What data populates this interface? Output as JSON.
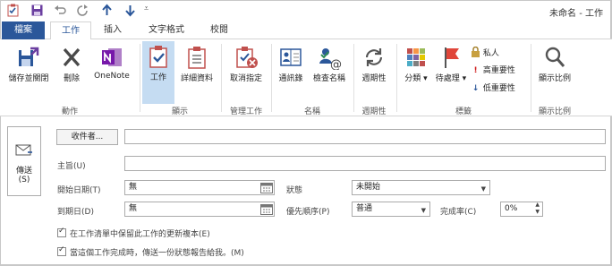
{
  "window_title": "未命名 - 工作",
  "tabs": {
    "file": "檔案",
    "task": "工作",
    "insert": "插入",
    "format": "文字格式",
    "review": "校閱"
  },
  "ribbon": {
    "save_close": "儲存並關閉",
    "delete": "刪除",
    "onenote": "OneNote",
    "task": "工作",
    "details": "詳細資料",
    "cancel_assign": "取消指定",
    "address_book": "通訊錄",
    "check_names": "檢查名稱",
    "recurrence": "週期性",
    "categorize": "分類",
    "follow_up": "待處理",
    "private": "私人",
    "high_importance": "高重要性",
    "low_importance": "低重要性",
    "zoom": "顯示比例",
    "groups": {
      "actions": "動作",
      "show": "顯示",
      "manage": "管理工作",
      "names": "名稱",
      "recurrence": "週期性",
      "tags": "標籤",
      "zoom": "顯示比例"
    }
  },
  "form": {
    "send_label": "傳送",
    "send_key": "(S)",
    "to_button": "收件者...",
    "to_value": "",
    "subject_label": "主旨(U)",
    "subject_value": "",
    "start_label": "開始日期(T)",
    "start_value": "無",
    "due_label": "到期日(D)",
    "due_value": "無",
    "status_label": "狀態",
    "status_value": "未開始",
    "priority_label": "優先順序(P)",
    "priority_value": "普通",
    "complete_label": "完成率(C)",
    "complete_value": "0%",
    "keep_copy": "在工作清單中保留此工作的更新複本(E)",
    "status_report": "當這個工作完成時，傳送一份狀態報告給我。(M)"
  }
}
